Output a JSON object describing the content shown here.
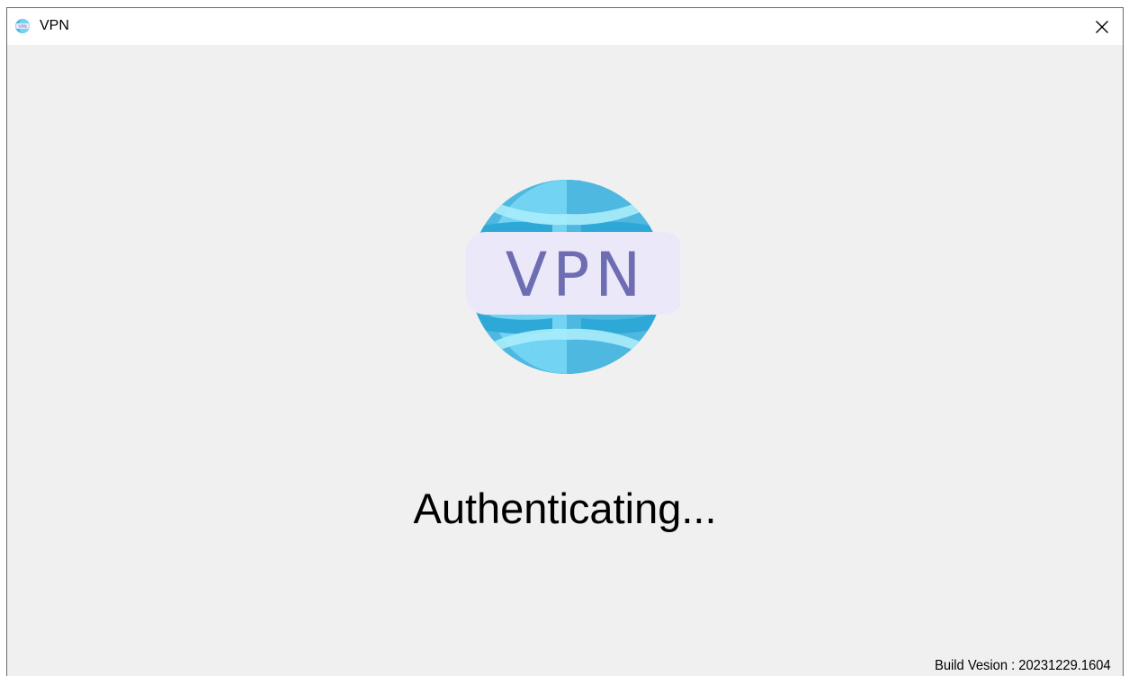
{
  "window": {
    "title": "VPN",
    "app_icon": "vpn-globe-icon",
    "close_icon": "close-icon"
  },
  "logo": {
    "text": "VPN",
    "icon": "vpn-globe-logo",
    "colors": {
      "globe_dark": "#2ea8d6",
      "globe_mid": "#4fb8e0",
      "globe_light": "#72d3f2",
      "globe_pale": "#a8ecfb",
      "banner": "#ebe8fa",
      "text": "#6e6db2"
    }
  },
  "status": {
    "text": "Authenticating..."
  },
  "footer": {
    "build_version": "Build Vesion : 20231229.1604"
  }
}
